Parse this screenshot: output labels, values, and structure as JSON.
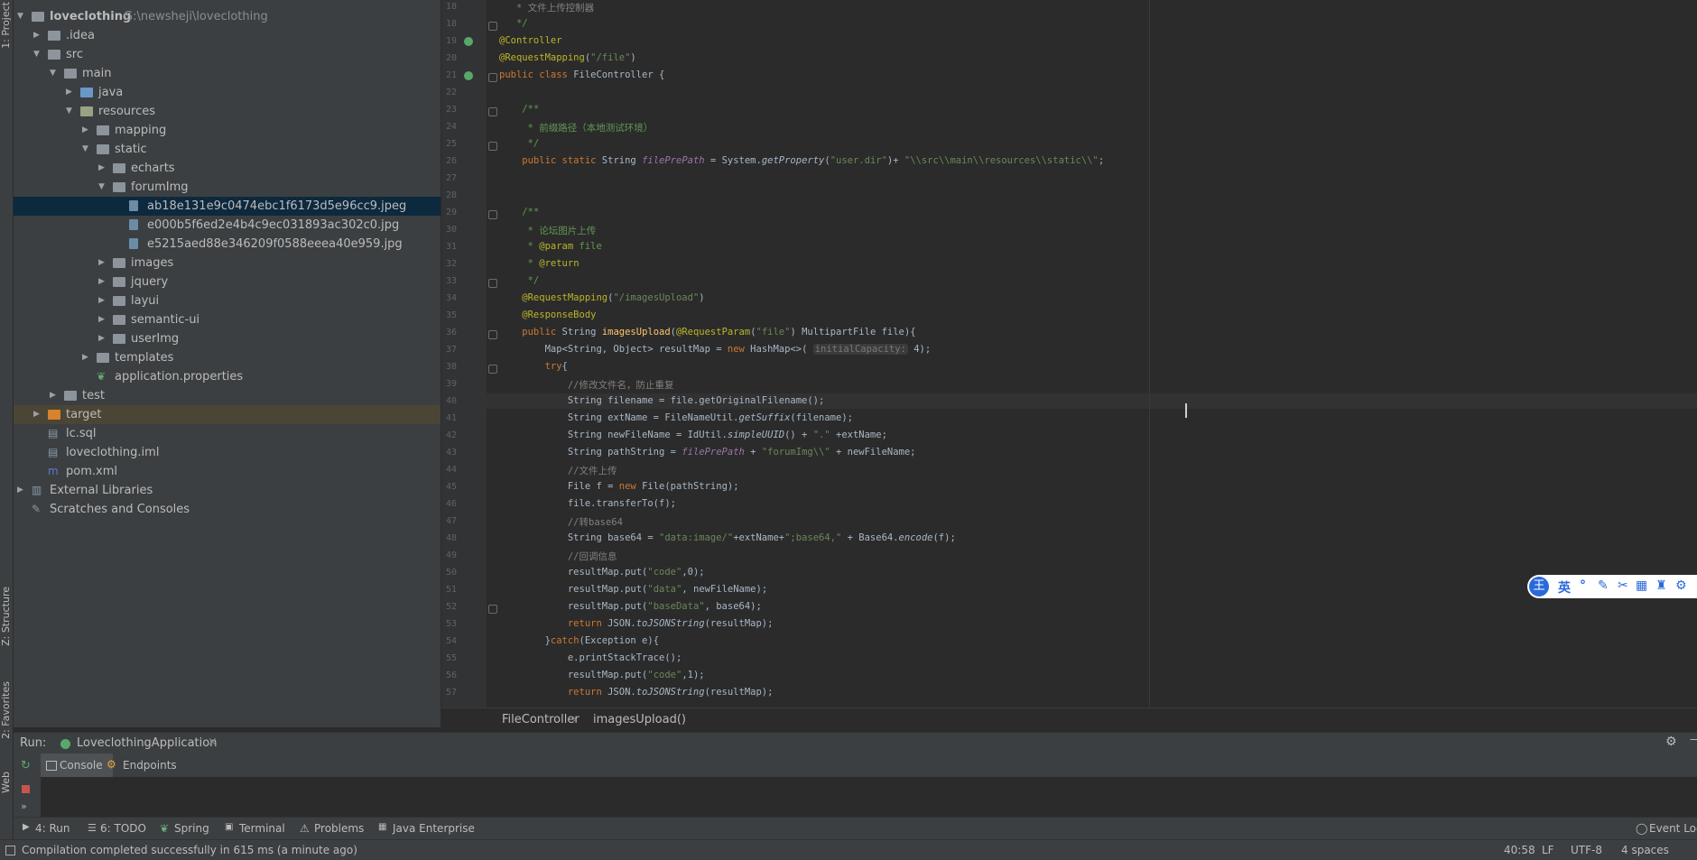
{
  "left_strip": {
    "project": "1: Project",
    "structure": "Z: Structure",
    "favorites": "2: Favorites",
    "web": "Web"
  },
  "project_tree": [
    {
      "label": "loveclothing",
      "path": "G:\\newsheji\\loveclothing",
      "indent": 0,
      "arrow": "down",
      "icon": "folder",
      "bold": true
    },
    {
      "label": ".idea",
      "indent": 1,
      "arrow": "right",
      "icon": "folder"
    },
    {
      "label": "src",
      "indent": 1,
      "arrow": "down",
      "icon": "folder"
    },
    {
      "label": "main",
      "indent": 2,
      "arrow": "down",
      "icon": "folder"
    },
    {
      "label": "java",
      "indent": 3,
      "arrow": "right",
      "icon": "java"
    },
    {
      "label": "resources",
      "indent": 3,
      "arrow": "down",
      "icon": "res"
    },
    {
      "label": "mapping",
      "indent": 4,
      "arrow": "right",
      "icon": "folder"
    },
    {
      "label": "static",
      "indent": 4,
      "arrow": "down",
      "icon": "folder"
    },
    {
      "label": "echarts",
      "indent": 5,
      "arrow": "right",
      "icon": "folder"
    },
    {
      "label": "forumImg",
      "indent": 5,
      "arrow": "down",
      "icon": "folder"
    },
    {
      "label": "ab18e131e9c0474ebc1f6173d5e96cc9.jpeg",
      "indent": 6,
      "arrow": "",
      "icon": "image",
      "selected": true
    },
    {
      "label": "e000b5f6ed2e4b4c9ec031893ac302c0.jpg",
      "indent": 6,
      "arrow": "",
      "icon": "image"
    },
    {
      "label": "e5215aed88e346209f0588eeea40e959.jpg",
      "indent": 6,
      "arrow": "",
      "icon": "image"
    },
    {
      "label": "images",
      "indent": 5,
      "arrow": "right",
      "icon": "folder"
    },
    {
      "label": "jquery",
      "indent": 5,
      "arrow": "right",
      "icon": "folder"
    },
    {
      "label": "layui",
      "indent": 5,
      "arrow": "right",
      "icon": "folder"
    },
    {
      "label": "semantic-ui",
      "indent": 5,
      "arrow": "right",
      "icon": "folder"
    },
    {
      "label": "userImg",
      "indent": 5,
      "arrow": "right",
      "icon": "folder"
    },
    {
      "label": "templates",
      "indent": 4,
      "arrow": "right",
      "icon": "folder"
    },
    {
      "label": "application.properties",
      "indent": 4,
      "arrow": "",
      "icon": "leaf"
    },
    {
      "label": "test",
      "indent": 2,
      "arrow": "right",
      "icon": "folder"
    },
    {
      "label": "target",
      "indent": 1,
      "arrow": "right",
      "icon": "orange",
      "excluded": true
    },
    {
      "label": "lc.sql",
      "indent": 1,
      "arrow": "",
      "icon": "sql"
    },
    {
      "label": "loveclothing.iml",
      "indent": 1,
      "arrow": "",
      "icon": "iml"
    },
    {
      "label": "pom.xml",
      "indent": 1,
      "arrow": "",
      "icon": "maven"
    },
    {
      "label": "External Libraries",
      "indent": 0,
      "arrow": "right",
      "icon": "libs"
    },
    {
      "label": "Scratches and Consoles",
      "indent": 0,
      "arrow": "",
      "icon": "scratch"
    }
  ],
  "code_lines": [
    {
      "n": "18",
      "parts": [
        [
          "cm",
          "   * 文件上传控制器"
        ]
      ]
    },
    {
      "n": "18",
      "parts": [
        [
          "dc",
          "   */"
        ]
      ]
    },
    {
      "n": "19",
      "parts": [
        [
          "an",
          "@Controller"
        ]
      ]
    },
    {
      "n": "20",
      "parts": [
        [
          "an",
          "@RequestMapping"
        ],
        [
          "",
          "("
        ],
        [
          "st",
          "\"/file\""
        ],
        [
          "",
          ")"
        ]
      ]
    },
    {
      "n": "21",
      "parts": [
        [
          "kw",
          "public class "
        ],
        [
          "",
          "FileController {"
        ]
      ]
    },
    {
      "n": "22",
      "parts": []
    },
    {
      "n": "23",
      "parts": [
        [
          "dc",
          "    /**"
        ]
      ]
    },
    {
      "n": "24",
      "parts": [
        [
          "dc",
          "     * 前缀路径（本地测试环境）"
        ]
      ]
    },
    {
      "n": "25",
      "parts": [
        [
          "dc",
          "     */"
        ]
      ]
    },
    {
      "n": "26",
      "parts": [
        [
          "kw",
          "    public static "
        ],
        [
          "",
          "String "
        ],
        [
          "sf",
          "filePrePath"
        ],
        [
          "",
          " = System."
        ],
        [
          "it",
          "getProperty"
        ],
        [
          "",
          "("
        ],
        [
          "st",
          "\"user.dir\""
        ],
        [
          "",
          ")+ "
        ],
        [
          "st",
          "\"\\\\src\\\\main\\\\resources\\\\static\\\\\""
        ],
        [
          "",
          ";"
        ]
      ]
    },
    {
      "n": "27",
      "parts": []
    },
    {
      "n": "28",
      "parts": []
    },
    {
      "n": "29",
      "parts": [
        [
          "dc",
          "    /**"
        ]
      ]
    },
    {
      "n": "30",
      "parts": [
        [
          "dc",
          "     * 论坛图片上传"
        ]
      ]
    },
    {
      "n": "31",
      "parts": [
        [
          "dc",
          "     * "
        ],
        [
          "an",
          "@param"
        ],
        [
          "dc",
          " file"
        ]
      ]
    },
    {
      "n": "32",
      "parts": [
        [
          "dc",
          "     * "
        ],
        [
          "an",
          "@return"
        ]
      ]
    },
    {
      "n": "33",
      "parts": [
        [
          "dc",
          "     */"
        ]
      ]
    },
    {
      "n": "34",
      "parts": [
        [
          "an",
          "    @RequestMapping"
        ],
        [
          "",
          "("
        ],
        [
          "st",
          "\"/imagesUpload\""
        ],
        [
          "",
          ")"
        ]
      ]
    },
    {
      "n": "35",
      "parts": [
        [
          "an",
          "    @ResponseBody"
        ]
      ]
    },
    {
      "n": "36",
      "parts": [
        [
          "kw",
          "    public "
        ],
        [
          "",
          "String "
        ],
        [
          "fn",
          "imagesUpload"
        ],
        [
          "",
          "("
        ],
        [
          "an",
          "@RequestParam"
        ],
        [
          "",
          "("
        ],
        [
          "st",
          "\"file\""
        ],
        [
          "",
          ") MultipartFile file){"
        ]
      ]
    },
    {
      "n": "37",
      "parts": [
        [
          "",
          "        Map<String, Object> resultMap = "
        ],
        [
          "kw",
          "new "
        ],
        [
          "",
          "HashMap<>( "
        ],
        [
          "hint",
          "initialCapacity:"
        ],
        [
          "",
          " 4);"
        ]
      ]
    },
    {
      "n": "38",
      "parts": [
        [
          "kw",
          "        try"
        ],
        [
          "",
          "{"
        ]
      ]
    },
    {
      "n": "39",
      "parts": [
        [
          "cm",
          "            //修改文件名，防止重复"
        ]
      ]
    },
    {
      "n": "40",
      "parts": [
        [
          "",
          "            String filename = file.getOriginalFilename();"
        ]
      ]
    },
    {
      "n": "41",
      "parts": [
        [
          "",
          "            String extName = FileNameUtil."
        ],
        [
          "it",
          "getSuffix"
        ],
        [
          "",
          "(filename);"
        ]
      ]
    },
    {
      "n": "42",
      "parts": [
        [
          "",
          "            String newFileName = IdUtil."
        ],
        [
          "it",
          "simpleUUID"
        ],
        [
          "",
          "() + "
        ],
        [
          "st",
          "\".\""
        ],
        [
          "",
          " +extName;"
        ]
      ]
    },
    {
      "n": "43",
      "parts": [
        [
          "",
          "            String pathString = "
        ],
        [
          "sf",
          "filePrePath"
        ],
        [
          "",
          " + "
        ],
        [
          "st",
          "\"forumImg\\\\\""
        ],
        [
          "",
          " + newFileName;"
        ]
      ]
    },
    {
      "n": "44",
      "parts": [
        [
          "cm",
          "            //文件上传"
        ]
      ]
    },
    {
      "n": "45",
      "parts": [
        [
          "",
          "            File f = "
        ],
        [
          "kw",
          "new "
        ],
        [
          "",
          "File(pathString);"
        ]
      ]
    },
    {
      "n": "46",
      "parts": [
        [
          "",
          "            file.transferTo(f);"
        ]
      ]
    },
    {
      "n": "47",
      "parts": [
        [
          "cm",
          "            //转base64"
        ]
      ]
    },
    {
      "n": "48",
      "parts": [
        [
          "",
          "            String base64 = "
        ],
        [
          "st",
          "\"data:image/\""
        ],
        [
          "",
          "+extName+"
        ],
        [
          "st",
          "\";base64,\""
        ],
        [
          "",
          " + Base64."
        ],
        [
          "it",
          "encode"
        ],
        [
          "",
          "(f);"
        ]
      ]
    },
    {
      "n": "49",
      "parts": [
        [
          "cm",
          "            //回调信息"
        ]
      ]
    },
    {
      "n": "50",
      "parts": [
        [
          "",
          "            resultMap.put("
        ],
        [
          "st",
          "\"code\""
        ],
        [
          "",
          ",0);"
        ]
      ]
    },
    {
      "n": "51",
      "parts": [
        [
          "",
          "            resultMap.put("
        ],
        [
          "st",
          "\"data\""
        ],
        [
          "",
          ", newFileName);"
        ]
      ]
    },
    {
      "n": "52",
      "parts": [
        [
          "",
          "            resultMap.put("
        ],
        [
          "st",
          "\"baseData\""
        ],
        [
          "",
          ", base64);"
        ]
      ]
    },
    {
      "n": "53",
      "parts": [
        [
          "kw",
          "            return "
        ],
        [
          "",
          "JSON."
        ],
        [
          "it",
          "toJSONString"
        ],
        [
          "",
          "(resultMap);"
        ]
      ]
    },
    {
      "n": "54",
      "parts": [
        [
          "",
          "        }"
        ],
        [
          "kw",
          "catch"
        ],
        [
          "",
          "(Exception e){"
        ]
      ]
    },
    {
      "n": "55",
      "parts": [
        [
          "",
          "            e.printStackTrace();"
        ]
      ]
    },
    {
      "n": "56",
      "parts": [
        [
          "",
          "            resultMap.put("
        ],
        [
          "st",
          "\"code\""
        ],
        [
          "",
          ",1);"
        ]
      ]
    },
    {
      "n": "57",
      "parts": [
        [
          "kw",
          "            return "
        ],
        [
          "",
          "JSON."
        ],
        [
          "it",
          "toJSONString"
        ],
        [
          "",
          "(resultMap);"
        ]
      ]
    }
  ],
  "breadcrumb": {
    "class": "FileController",
    "method": "imagesUpload()"
  },
  "run_panel": {
    "label": "Run:",
    "config": "LoveclothingApplication",
    "tabs": [
      "Console",
      "Endpoints"
    ]
  },
  "tool_tabs": [
    "4: Run",
    "6: TODO",
    "Spring",
    "Terminal",
    "Problems",
    "Java Enterprise"
  ],
  "event_log": "Event Log",
  "status": {
    "message": "Compilation completed successfully in 615 ms (a minute ago)",
    "position": "40:58",
    "line_sep": "LF",
    "encoding": "UTF-8",
    "indent": "4 spaces"
  },
  "ime": {
    "brand": "王",
    "lang": "英"
  }
}
